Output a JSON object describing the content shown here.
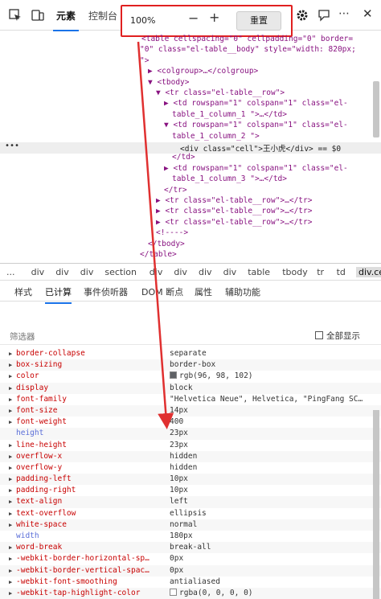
{
  "toolbar": {
    "tabs": [
      {
        "label": "元素"
      },
      {
        "label": "控制台"
      }
    ],
    "zoom_value": "100%",
    "zoom_minus": "−",
    "zoom_plus": "+",
    "zoom_reset": "重置",
    "count": "1"
  },
  "dom_lines": [
    {
      "indent": 0,
      "text": "<table cellspacing=\"0\" cellpadding=\"0\" border="
    },
    {
      "indent": 0,
      "text": "\"0\" class=\"el-table__body\" style=\"width: 820px;"
    },
    {
      "indent": 0,
      "text": "\">"
    },
    {
      "indent": 1,
      "text": "▶ <colgroup>…</colgroup>"
    },
    {
      "indent": 1,
      "text": "▼ <tbody>"
    },
    {
      "indent": 2,
      "text": "▼ <tr class=\"el-table__row\">"
    },
    {
      "indent": 3,
      "text": "▶ <td rowspan=\"1\" colspan=\"1\" class=\"el-"
    },
    {
      "indent": 4,
      "text": "table_1_column_1  \">…</td>"
    },
    {
      "indent": 3,
      "text": "▼ <td rowspan=\"1\" colspan=\"1\" class=\"el-"
    },
    {
      "indent": 4,
      "text": "table_1_column_2  \">"
    },
    {
      "indent": 5,
      "text": "<div class=\"cell\">王小虎</div> == $0"
    },
    {
      "indent": 4,
      "text": "</td>"
    },
    {
      "indent": 3,
      "text": "▶ <td rowspan=\"1\" colspan=\"1\" class=\"el-"
    },
    {
      "indent": 4,
      "text": "table_1_column_3  \">…</td>"
    },
    {
      "indent": 3,
      "text": "</tr>"
    },
    {
      "indent": 2,
      "text": "▶ <tr class=\"el-table__row\">…</tr>"
    },
    {
      "indent": 2,
      "text": "▶ <tr class=\"el-table__row\">…</tr>"
    },
    {
      "indent": 2,
      "text": "▶ <tr class=\"el-table__row\">…</tr>"
    },
    {
      "indent": 2,
      "text": "<!---->"
    },
    {
      "indent": 1,
      "text": "</tbody>"
    },
    {
      "indent": 0,
      "text": "</table>"
    }
  ],
  "breadcrumb": [
    "...",
    "div",
    "div",
    "div",
    "section",
    "div",
    "div",
    "div",
    "div",
    "table",
    "tbody",
    "tr",
    "td",
    "div.cell"
  ],
  "subtabs": [
    {
      "label": "样式"
    },
    {
      "label": "已计算"
    },
    {
      "label": "事件侦听器"
    },
    {
      "label": "DOM 断点"
    },
    {
      "label": "属性"
    },
    {
      "label": "辅助功能"
    }
  ],
  "filter": {
    "label": "筛选器",
    "show_all": "全部显示"
  },
  "computed": [
    {
      "name": "border-collapse",
      "value": "separate",
      "expandable": true
    },
    {
      "name": "box-sizing",
      "value": "border-box",
      "expandable": true
    },
    {
      "name": "color",
      "value": "rgb(96, 98, 102)",
      "expandable": true,
      "swatch": "#606266"
    },
    {
      "name": "display",
      "value": "block",
      "expandable": true
    },
    {
      "name": "font-family",
      "value": "\"Helvetica Neue\", Helvetica, \"PingFang SC…",
      "expandable": true
    },
    {
      "name": "font-size",
      "value": "14px",
      "expandable": true
    },
    {
      "name": "font-weight",
      "value": "400",
      "expandable": true
    },
    {
      "name": "height",
      "value": "23px",
      "expandable": false
    },
    {
      "name": "line-height",
      "value": "23px",
      "expandable": true
    },
    {
      "name": "overflow-x",
      "value": "hidden",
      "expandable": true
    },
    {
      "name": "overflow-y",
      "value": "hidden",
      "expandable": true
    },
    {
      "name": "padding-left",
      "value": "10px",
      "expandable": true
    },
    {
      "name": "padding-right",
      "value": "10px",
      "expandable": true
    },
    {
      "name": "text-align",
      "value": "left",
      "expandable": true
    },
    {
      "name": "text-overflow",
      "value": "ellipsis",
      "expandable": true
    },
    {
      "name": "white-space",
      "value": "normal",
      "expandable": true
    },
    {
      "name": "width",
      "value": "180px",
      "expandable": false
    },
    {
      "name": "word-break",
      "value": "break-all",
      "expandable": true
    },
    {
      "name": "-webkit-border-horizontal-sp…",
      "value": "0px",
      "expandable": true
    },
    {
      "name": "-webkit-border-vertical-spac…",
      "value": "0px",
      "expandable": true
    },
    {
      "name": "-webkit-font-smoothing",
      "value": "antialiased",
      "expandable": true
    },
    {
      "name": "-webkit-tap-highlight-color",
      "value": "rgba(0, 0, 0, 0)",
      "expandable": true,
      "swatch": "#ffffff"
    }
  ],
  "colors": {
    "accent": "#1a73e8",
    "highlight_box": "#e02020",
    "arrow": "#e03030"
  }
}
